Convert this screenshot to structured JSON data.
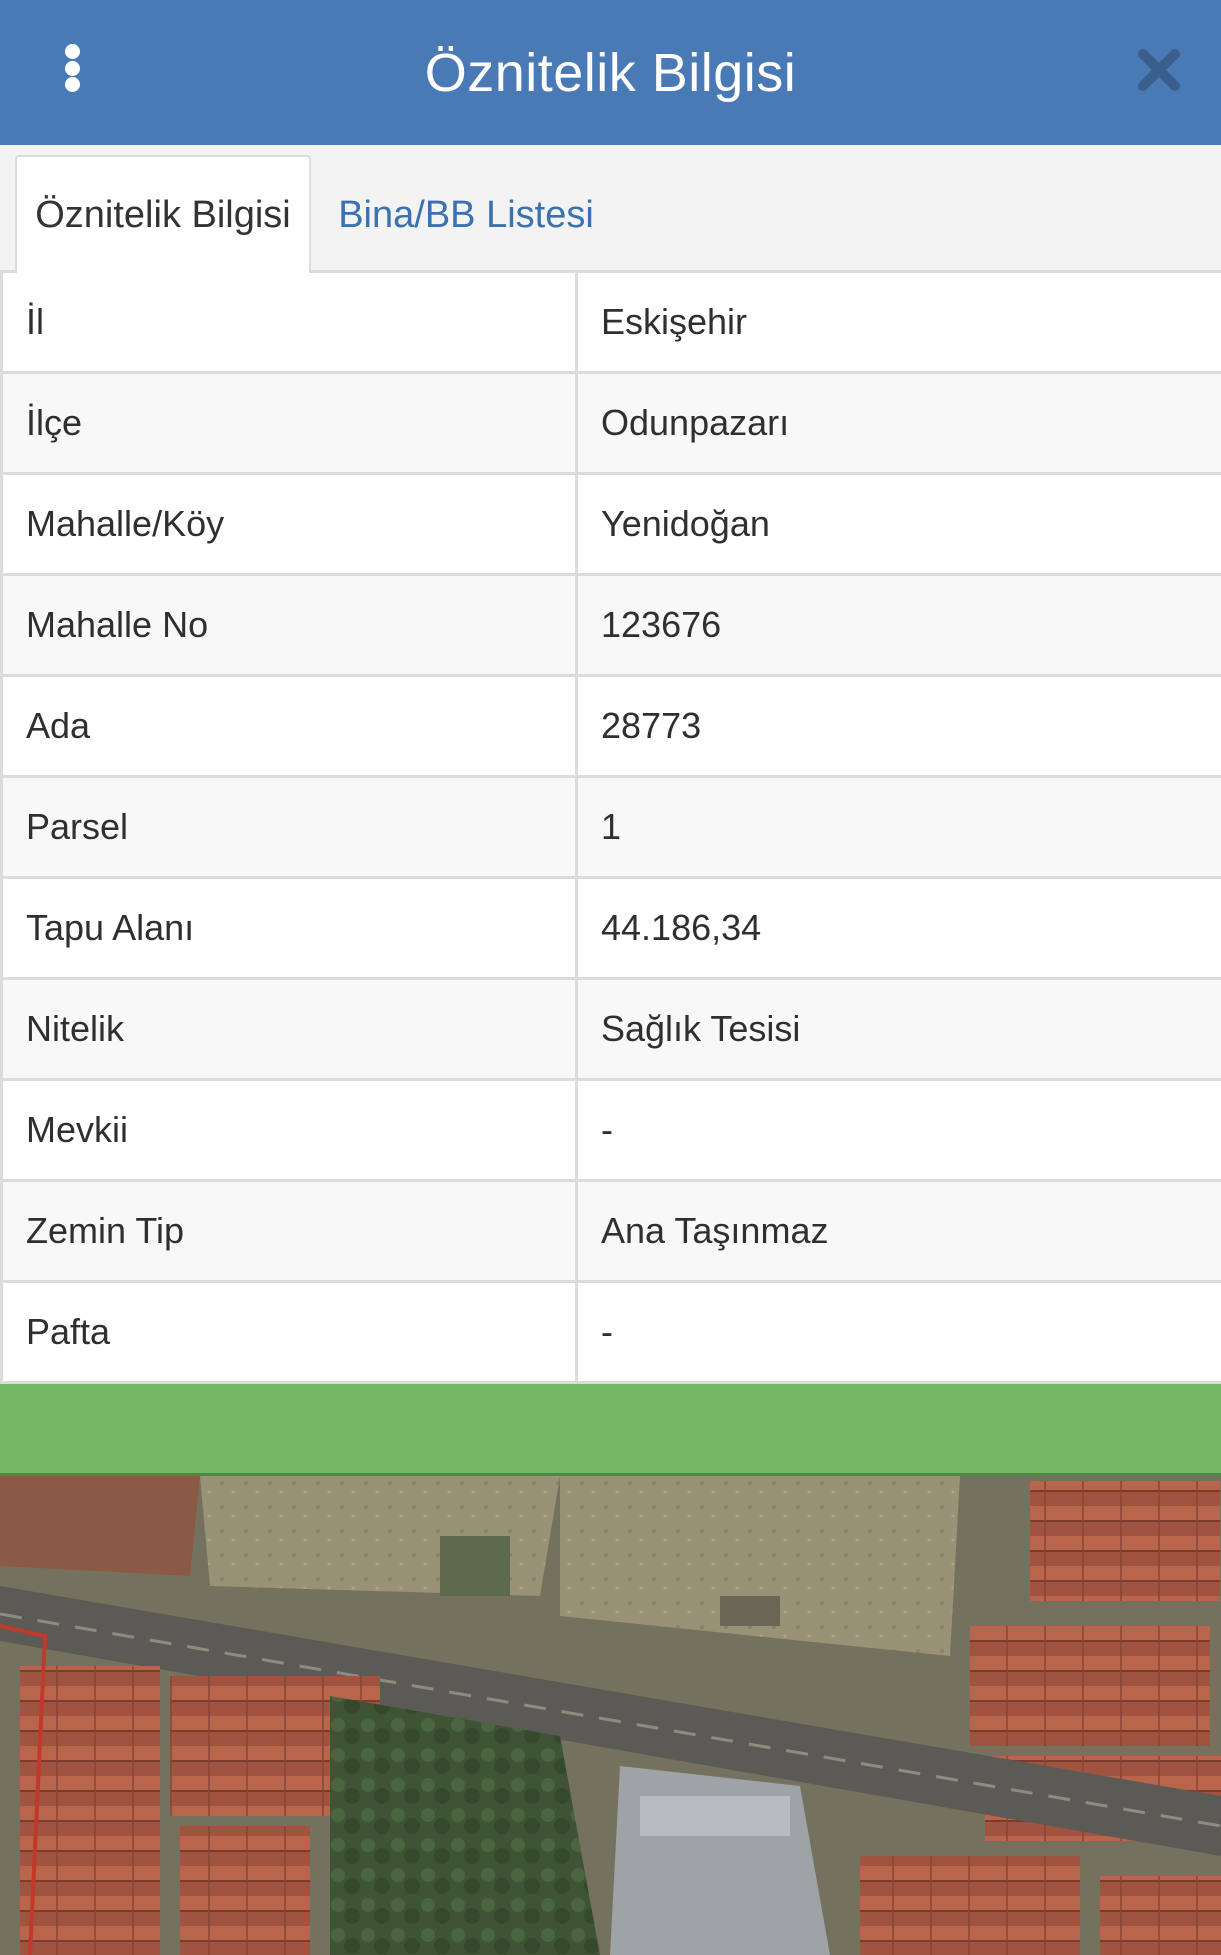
{
  "header": {
    "title": "Öznitelik Bilgisi",
    "menu_icon": "vertical-dots-icon",
    "close_icon": "close-icon",
    "background_color": "#4a7ab5"
  },
  "tabs": [
    {
      "label": "Öznitelik Bilgisi",
      "active": true
    },
    {
      "label": "Bina/BB Listesi",
      "active": false
    }
  ],
  "attributes": [
    {
      "label": "İl",
      "value": "Eskişehir"
    },
    {
      "label": "İlçe",
      "value": "Odunpazarı"
    },
    {
      "label": "Mahalle/Köy",
      "value": "Yenidoğan"
    },
    {
      "label": "Mahalle No",
      "value": "123676"
    },
    {
      "label": "Ada",
      "value": "28773"
    },
    {
      "label": "Parsel",
      "value": "1"
    },
    {
      "label": "Tapu Alanı",
      "value": "44.186,34"
    },
    {
      "label": "Nitelik",
      "value": "Sağlık Tesisi"
    },
    {
      "label": "Mevkii",
      "value": "-"
    },
    {
      "label": "Zemin Tip",
      "value": "Ana Taşınmaz"
    },
    {
      "label": "Pafta",
      "value": "-"
    }
  ],
  "status_bar_color": "#72b865",
  "map": {
    "type": "satellite-imagery"
  }
}
